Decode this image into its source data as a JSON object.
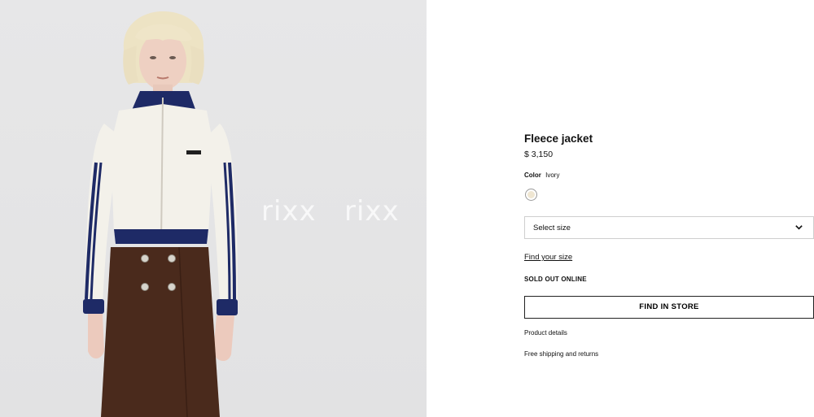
{
  "product": {
    "title": "Fleece jacket",
    "price": "$ 3,150",
    "color_label": "Color",
    "color_value": "Ivory",
    "swatch_color": "#efe6d2",
    "size_placeholder": "Select size",
    "find_size_link": "Find your size",
    "availability": "SOLD OUT ONLINE",
    "find_in_store_button": "FIND IN STORE",
    "product_details_link": "Product details",
    "shipping_link": "Free shipping and returns"
  },
  "image": {
    "watermark": "rixx",
    "jacket_label": "≡ ▯▯▯"
  },
  "icons": {
    "size_dropdown": "chevron-down-icon"
  },
  "colors": {
    "jacket_body": "#f3f1ea",
    "jacket_trim": "#1e2a66",
    "skirt": "#4a2a1c",
    "background": "#e5e5e6"
  }
}
